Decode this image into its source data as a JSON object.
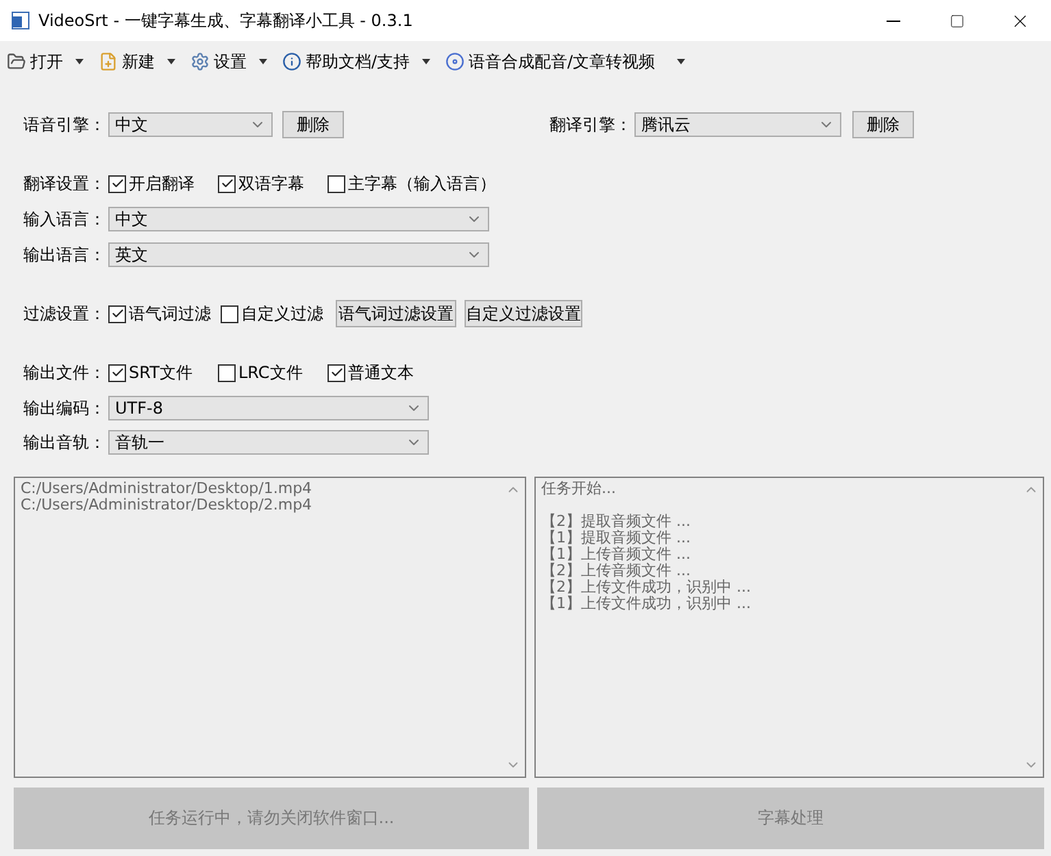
{
  "window": {
    "title": "VideoSrt - 一键字幕生成、字幕翻译小工具 - 0.3.1"
  },
  "menu": [
    {
      "label": "打开"
    },
    {
      "label": "新建"
    },
    {
      "label": "设置"
    },
    {
      "label": "帮助文档/支持"
    },
    {
      "label": "语音合成配音/文章转视频"
    }
  ],
  "speech_engine": {
    "label": "语音引擎：",
    "value": "中文",
    "button": "删除"
  },
  "translate_engine": {
    "label": "翻译引擎：",
    "value": "腾讯云",
    "button": "删除"
  },
  "translation_settings": {
    "label": "翻译设置：",
    "checkboxes": [
      {
        "label": "开启翻译",
        "checked": true
      },
      {
        "label": "双语字幕",
        "checked": true
      },
      {
        "label": "主字幕（输入语言）",
        "checked": false
      }
    ]
  },
  "input_language": {
    "label": "输入语言：",
    "value": "中文"
  },
  "output_language": {
    "label": "输出语言：",
    "value": "英文"
  },
  "filter_settings": {
    "label": "过滤设置：",
    "checkboxes": [
      {
        "label": "语气词过滤",
        "checked": true
      },
      {
        "label": "自定义过滤",
        "checked": false
      }
    ],
    "buttons": [
      "语气词过滤设置",
      "自定义过滤设置"
    ]
  },
  "output_files": {
    "label": "输出文件：",
    "checkboxes": [
      {
        "label": "SRT文件",
        "checked": true
      },
      {
        "label": "LRC文件",
        "checked": false
      },
      {
        "label": "普通文本",
        "checked": true
      }
    ]
  },
  "output_encoding": {
    "label": "输出编码：",
    "value": "UTF-8"
  },
  "output_track": {
    "label": "输出音轨：",
    "value": "音轨一"
  },
  "file_list": [
    "C:/Users/Administrator/Desktop/1.mp4",
    "C:/Users/Administrator/Desktop/2.mp4"
  ],
  "log": {
    "header": "任务开始...",
    "lines": [
      "【2】提取音频文件 ...",
      "【1】提取音频文件 ...",
      "【1】上传音频文件 ...",
      "【2】上传音频文件 ...",
      "【2】上传文件成功，识别中 ...",
      "【1】上传文件成功，识别中 ..."
    ]
  },
  "actions": [
    {
      "label": "任务运行中，请勿关闭软件窗口...",
      "disabled": true
    },
    {
      "label": "字幕处理",
      "disabled": true
    }
  ]
}
